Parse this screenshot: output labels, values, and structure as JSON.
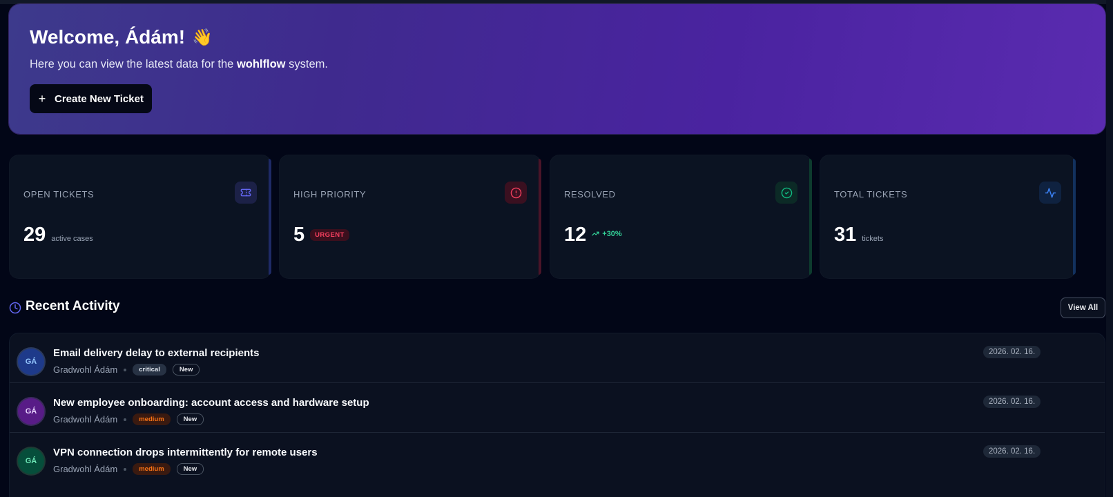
{
  "hero": {
    "title": "Welcome, Ádám!",
    "wave_emoji": "👋",
    "subtitle_prefix": "Here you can view the latest data for the",
    "system_name": "wohlflow",
    "subtitle_suffix": "system.",
    "create_button_label": "Create New Ticket",
    "create_button_icon": "plus-icon"
  },
  "stats": [
    {
      "label": "OPEN TICKETS",
      "value": "29",
      "note": "active cases",
      "icon": "ticket-icon",
      "color": "#6366f1"
    },
    {
      "label": "HIGH PRIORITY",
      "value": "5",
      "badge": "URGENT",
      "icon": "alert-circle-icon",
      "color": "#f43f5e"
    },
    {
      "label": "RESOLVED",
      "value": "12",
      "trend": "+30%",
      "icon": "check-circle-icon",
      "color": "#10b981"
    },
    {
      "label": "TOTAL TICKETS",
      "value": "31",
      "note": "tickets",
      "icon": "activity-icon",
      "color": "#3b82f6"
    }
  ],
  "recent_activity": {
    "title": "Recent Activity",
    "icon": "clock-icon",
    "view_all_label": "View All",
    "items": [
      {
        "initials": "GÁ",
        "title": "Email delivery delay to external recipients",
        "author": "Gradwohl Ádám",
        "priority": "critical",
        "status": "New",
        "date": "2026. 02. 16."
      },
      {
        "initials": "GÁ",
        "title": "New employee onboarding: account access and hardware setup",
        "author": "Gradwohl Ádám",
        "priority": "medium",
        "status": "New",
        "date": "2026. 02. 16."
      },
      {
        "initials": "GÁ",
        "title": "VPN connection drops intermittently for remote users",
        "author": "Gradwohl Ádám",
        "priority": "medium",
        "status": "New",
        "date": "2026. 02. 16."
      }
    ]
  }
}
